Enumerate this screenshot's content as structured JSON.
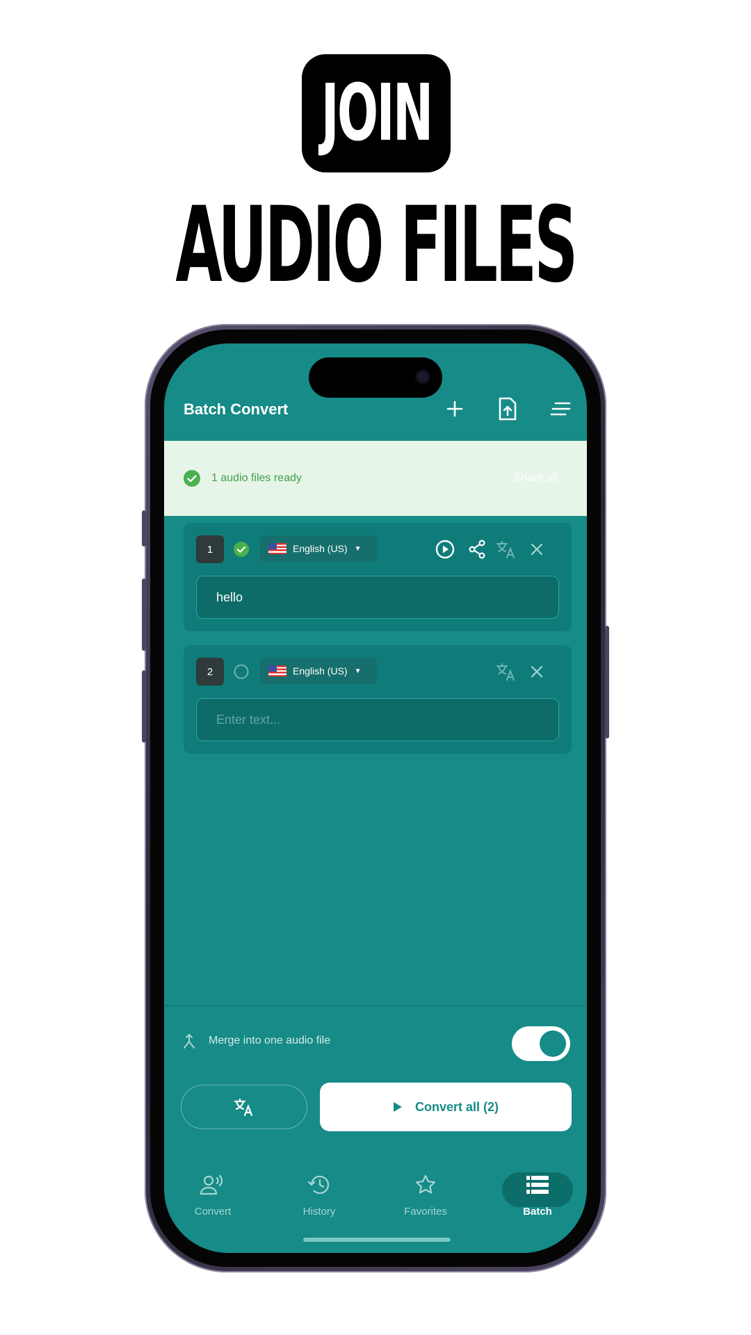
{
  "promo": {
    "badge": "JOIN",
    "headline": "AUDIO FILES"
  },
  "app_bar": {
    "title": "Batch Convert",
    "icons": [
      "plus-icon",
      "upload-file-icon",
      "sort-lines-icon"
    ]
  },
  "banner": {
    "message": "1 audio files ready",
    "action": "Share all"
  },
  "items": [
    {
      "index": "1",
      "status": "ready",
      "language": "English (US)",
      "text": "hello",
      "placeholder": ""
    },
    {
      "index": "2",
      "status": "pending",
      "language": "English (US)",
      "text": "",
      "placeholder": "Enter text..."
    }
  ],
  "merge": {
    "label": "Merge into one audio file",
    "enabled": true
  },
  "actions": {
    "convert_label": "Convert all (2)"
  },
  "nav": [
    {
      "label": "Convert",
      "icon": "voice-person-icon",
      "active": false
    },
    {
      "label": "History",
      "icon": "history-icon",
      "active": false
    },
    {
      "label": "Favorites",
      "icon": "star-icon",
      "active": false
    },
    {
      "label": "Batch",
      "icon": "batch-list-icon",
      "active": true
    }
  ],
  "colors": {
    "screen_bg": "#168b88",
    "card_bg": "#0f7c79",
    "banner_bg": "#e6f5e8",
    "success_green": "#4caf50"
  }
}
